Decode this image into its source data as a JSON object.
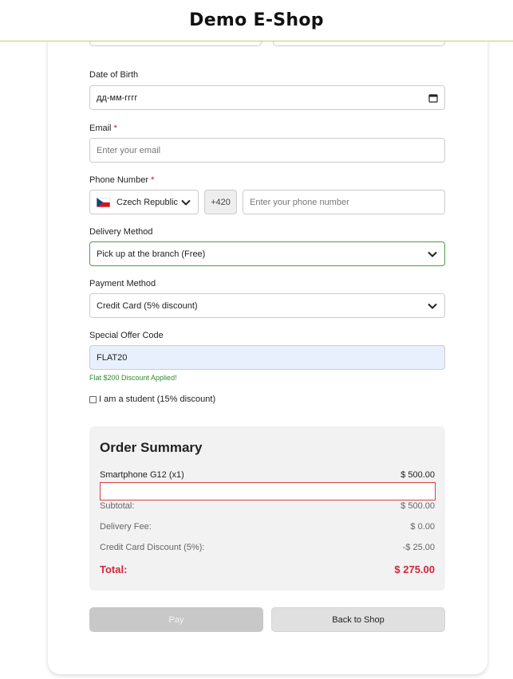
{
  "header": {
    "title": "Demo E-Shop"
  },
  "form": {
    "dob": {
      "label": "Date of Birth",
      "value": "дд-мм-гггг"
    },
    "email": {
      "label": "Email",
      "required_mark": "*",
      "placeholder": "Enter your email"
    },
    "phone": {
      "label": "Phone Number",
      "required_mark": "*",
      "country": "Czech Republic",
      "prefix": "+420",
      "placeholder": "Enter your phone number"
    },
    "delivery": {
      "label": "Delivery Method",
      "value": "Pick up at the branch (Free)"
    },
    "payment": {
      "label": "Payment Method",
      "value": "Credit Card (5% discount)"
    },
    "offer": {
      "label": "Special Offer Code",
      "value": "FLAT20",
      "message": "Flat $200 Discount Applied!"
    },
    "student": {
      "label": "I am a student (15% discount)",
      "checked": false
    }
  },
  "summary": {
    "title": "Order Summary",
    "item": {
      "name": "Smartphone G12 (x1)",
      "price": "$ 500.00"
    },
    "subtotal": {
      "label": "Subtotal:",
      "value": "$ 500.00"
    },
    "delivery_fee": {
      "label": "Delivery Fee:",
      "value": "$ 0.00"
    },
    "card_discount": {
      "label": "Credit Card Discount (5%):",
      "value": "-$ 25.00"
    },
    "total": {
      "label": "Total:",
      "value": "$ 275.00"
    }
  },
  "buttons": {
    "pay": "Pay",
    "back": "Back to Shop"
  },
  "colors": {
    "accent_green": "#4a9e4a",
    "total_red": "#d0263c",
    "offer_bg": "#e8f0fe",
    "error_border": "#d94040"
  },
  "icons": {
    "chevron": "chevron-down-icon",
    "calendar": "calendar-icon",
    "flag": "czech-flag-icon"
  }
}
